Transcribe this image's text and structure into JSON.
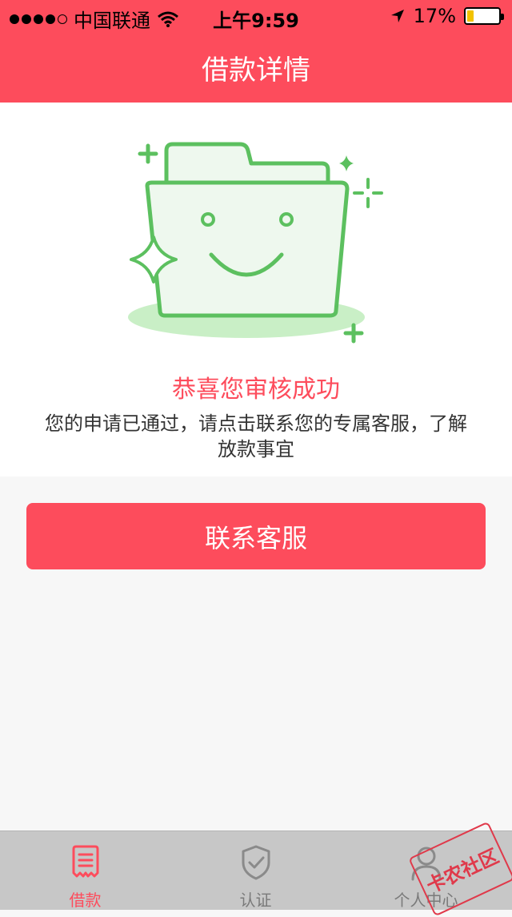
{
  "status_bar": {
    "carrier": "中国联通",
    "time": "上午9:59",
    "battery_percent": "17%"
  },
  "nav": {
    "title": "借款详情"
  },
  "result": {
    "title": "恭喜您审核成功",
    "description": "您的申请已通过，请点击联系您的专属客服，了解放款事宜"
  },
  "action": {
    "contact_label": "联系客服"
  },
  "tabs": [
    {
      "label": "借款",
      "icon": "loan-icon",
      "active": true
    },
    {
      "label": "认证",
      "icon": "shield-check-icon",
      "active": false
    },
    {
      "label": "个人中心",
      "icon": "person-icon",
      "active": false
    }
  ],
  "watermark": {
    "text": "卡农社区"
  },
  "colors": {
    "accent": "#fd4c5c",
    "success_green": "#5cc05f"
  }
}
